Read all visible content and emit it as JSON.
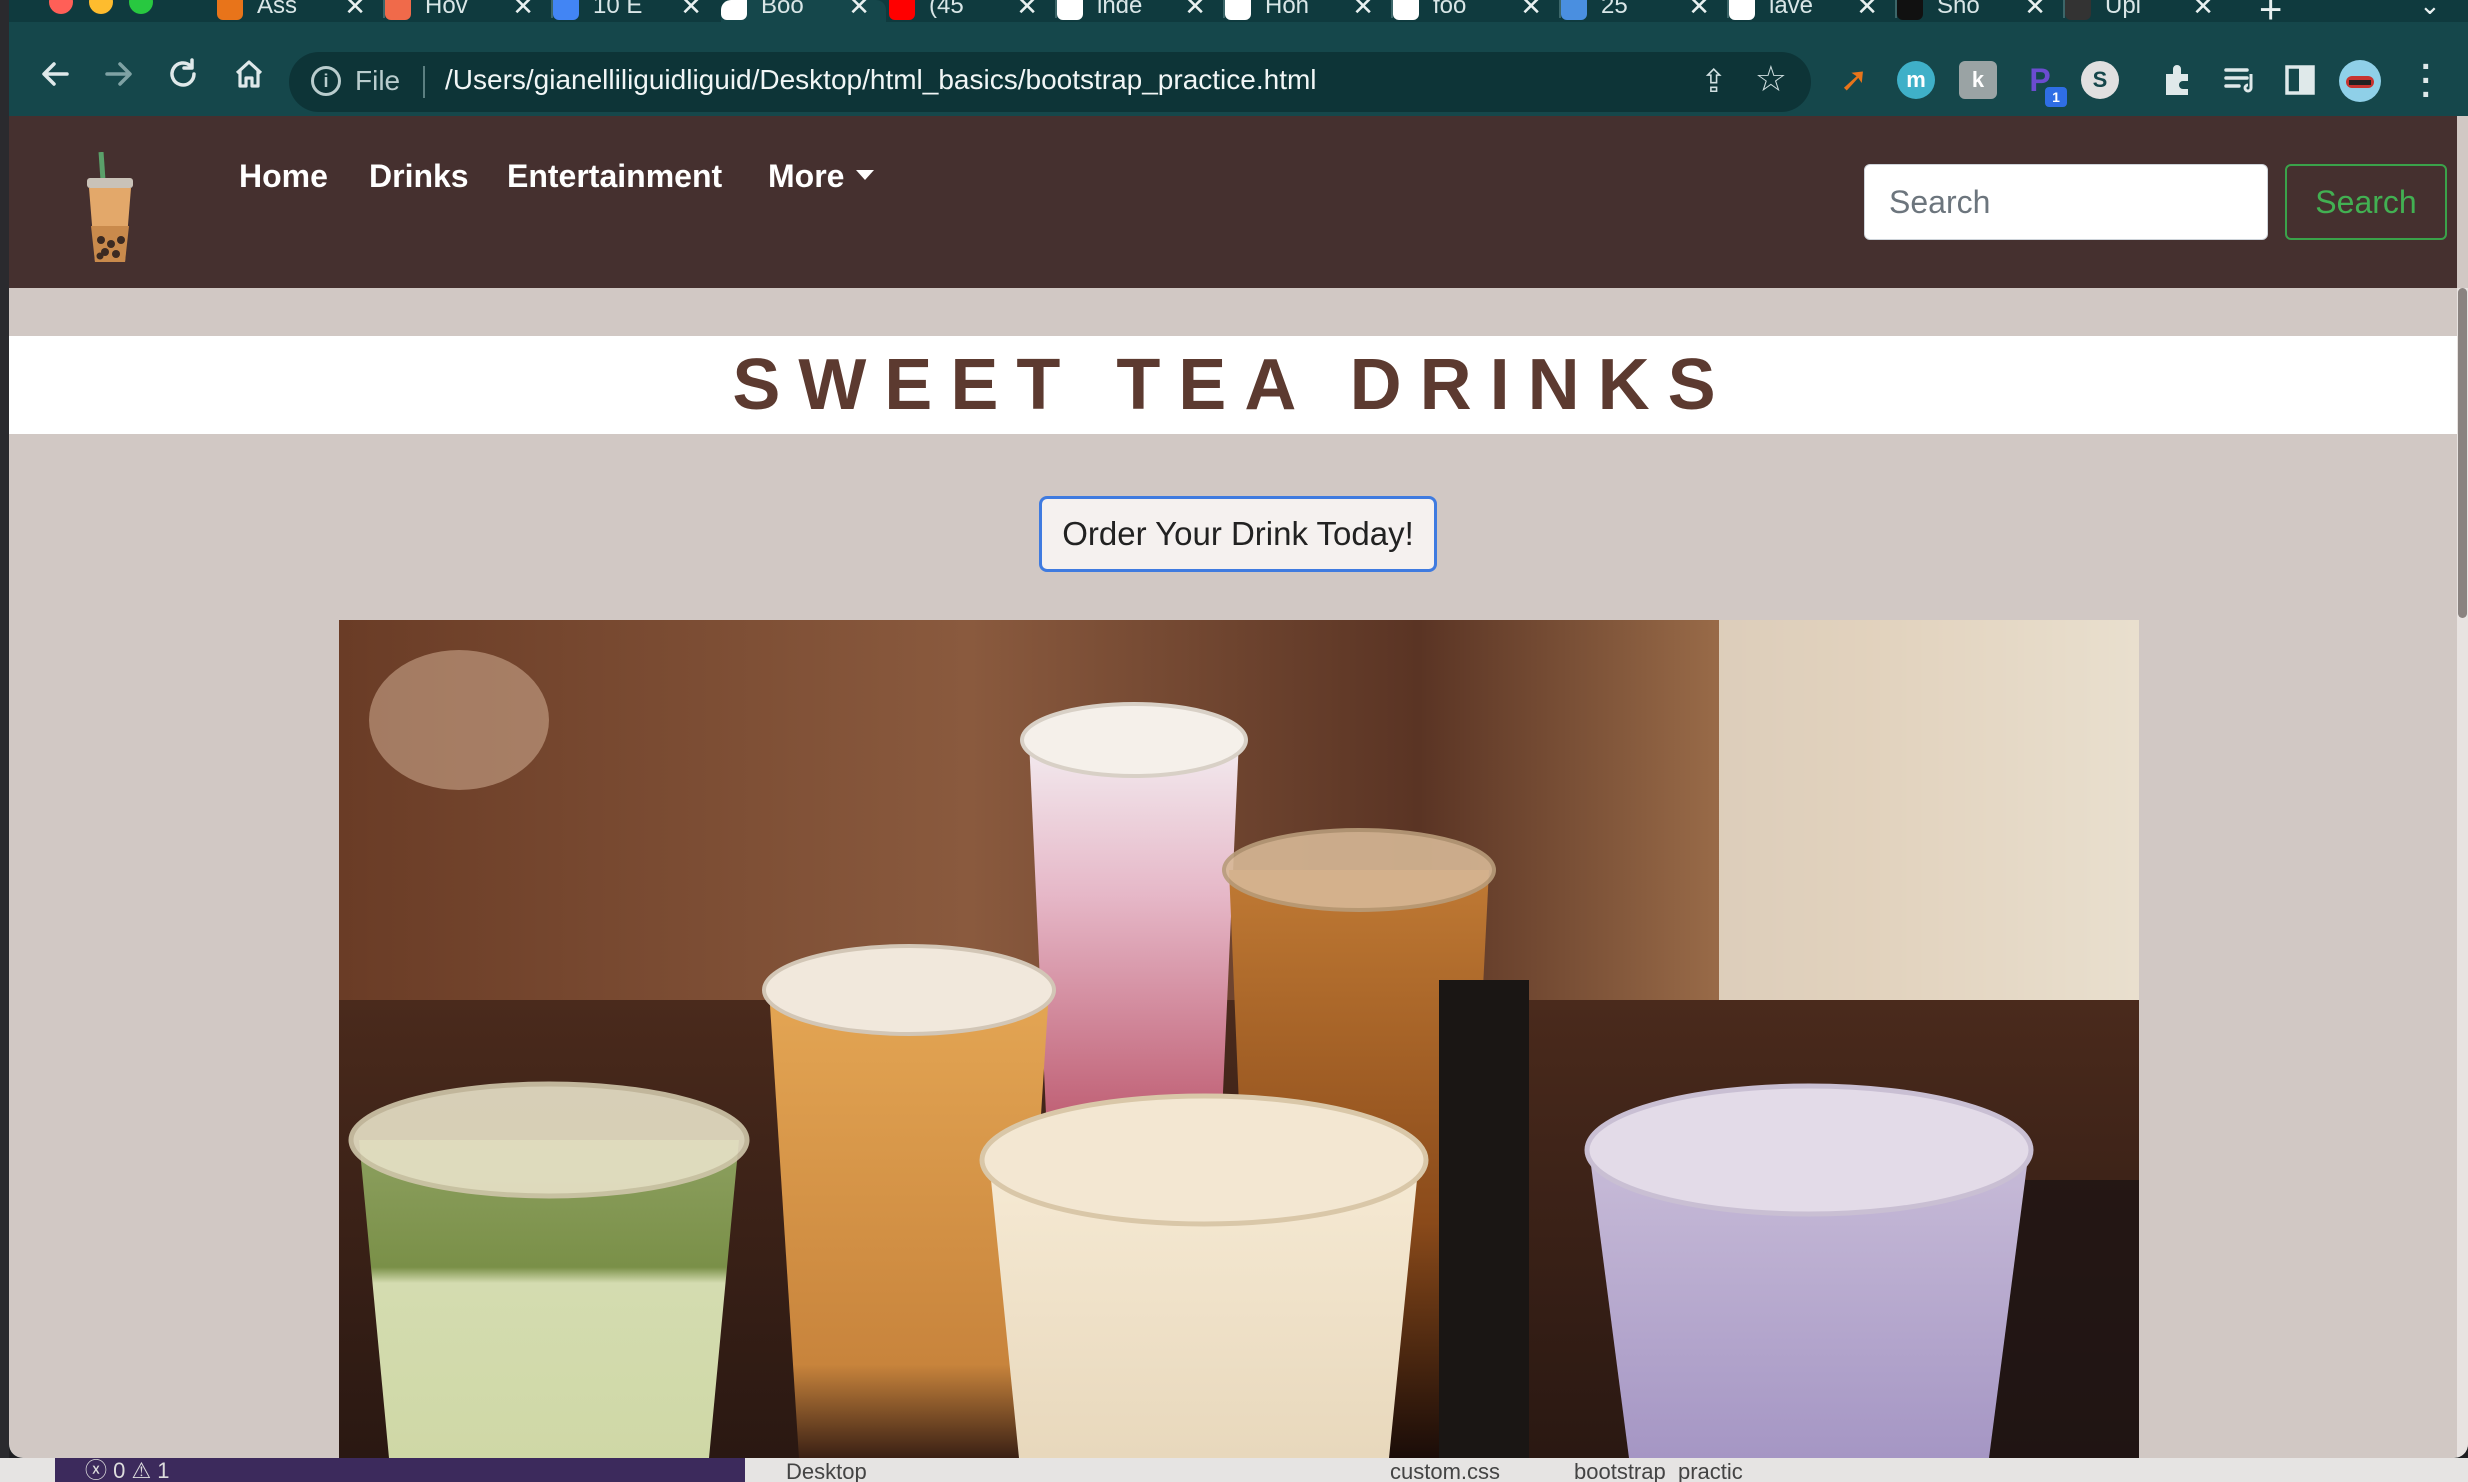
{
  "browser": {
    "tabs": [
      {
        "title": "Ass",
        "favicon_color": "#e8741a",
        "active": false
      },
      {
        "title": "Hov",
        "favicon_color": "#f06a4a",
        "active": false
      },
      {
        "title": "10 E",
        "favicon_color": "#4285f4",
        "active": false
      },
      {
        "title": "Boo",
        "favicon_color": "#ffffff",
        "active": true
      },
      {
        "title": "(45",
        "favicon_color": "#ff0000",
        "active": false
      },
      {
        "title": "inde",
        "favicon_color": "#ffffff",
        "active": false
      },
      {
        "title": "Hon",
        "favicon_color": "#ffffff",
        "active": false
      },
      {
        "title": "foo",
        "favicon_color": "#ffffff",
        "active": false
      },
      {
        "title": "25",
        "favicon_color": "#4a8fe0",
        "active": false
      },
      {
        "title": "lave",
        "favicon_color": "#ffffff",
        "active": false
      },
      {
        "title": "Sho",
        "favicon_color": "#111111",
        "active": false
      },
      {
        "title": "Upl",
        "favicon_color": "#333333",
        "active": false
      }
    ],
    "omnibox": {
      "scheme_label": "File",
      "url": "/Users/gianelliliguidliguid/Desktop/html_basics/bootstrap_practice.html"
    },
    "extensions": [
      {
        "name": "arrow-extension-icon",
        "glyph": "➚",
        "color": "#e8741a"
      },
      {
        "name": "m-extension-icon",
        "glyph": "m",
        "color": "#3fb0c8"
      },
      {
        "name": "k-extension-icon",
        "glyph": "k",
        "color": "#9aa3a4"
      },
      {
        "name": "p-extension-icon",
        "glyph": "P",
        "color": "#6b4cd0",
        "badge": "1"
      },
      {
        "name": "s-extension-icon",
        "glyph": "S",
        "color": "#e0e0e0"
      }
    ]
  },
  "site": {
    "nav": {
      "links": [
        "Home",
        "Drinks",
        "Entertainment",
        "More"
      ],
      "search_placeholder": "Search",
      "search_button": "Search"
    },
    "title": "SWEET TEA DRINKS",
    "order_button": "Order Your Drink Today!",
    "hero_alt": "boba-drinks-photo"
  },
  "bottom": {
    "status": "ⓧ 0 ⚠ 1",
    "desktop_label": "Desktop",
    "file_1": "custom.css",
    "file_2": "bootstrap_practic"
  },
  "colors": {
    "navbar": "#45302f",
    "page_bg": "#d1c8c4",
    "title": "#5c3a30",
    "search_green": "#42b052",
    "browser_chrome": "#15474b"
  }
}
